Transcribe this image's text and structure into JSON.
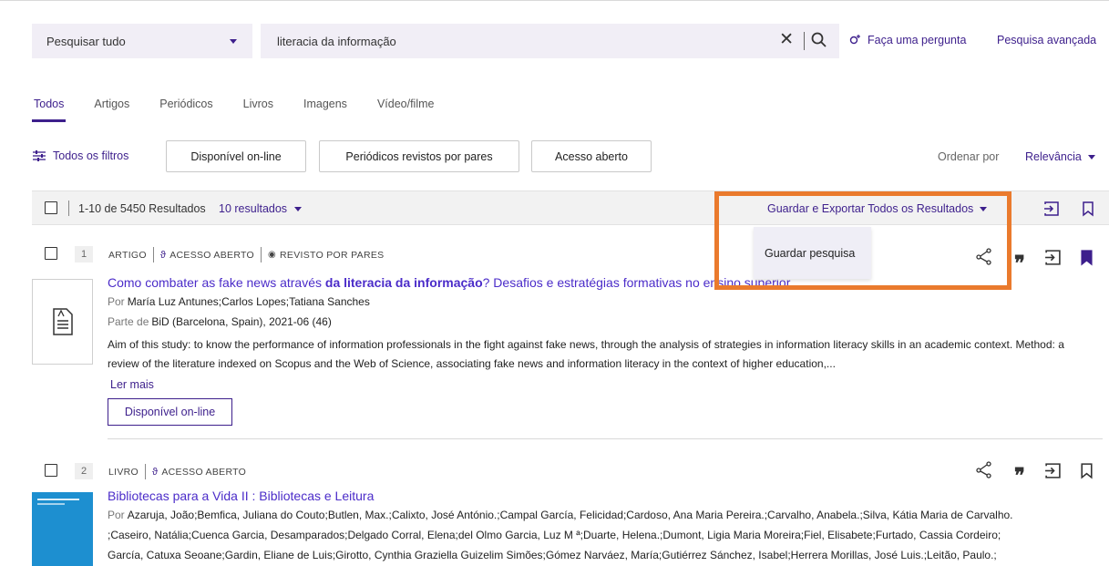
{
  "search": {
    "scope": "Pesquisar tudo",
    "query": "literacia da informação",
    "ask_label": "Faça uma pergunta",
    "advanced_label": "Pesquisa avançada"
  },
  "tabs": [
    {
      "label": "Todos",
      "active": true
    },
    {
      "label": "Artigos"
    },
    {
      "label": "Periódicos"
    },
    {
      "label": "Livros"
    },
    {
      "label": "Imagens"
    },
    {
      "label": "Vídeo/filme"
    }
  ],
  "filters": {
    "all_filters": "Todos os filtros",
    "chips": [
      "Disponível on-line",
      "Periódicos revistos por pares",
      "Acesso aberto"
    ],
    "sort_label": "Ordenar por",
    "sort_value": "Relevância"
  },
  "results_bar": {
    "range_text": "1-10 de 5450 Resultados",
    "per_page": "10 resultados",
    "export_label": "Guardar e Exportar Todos os Resultados",
    "dropdown_item": "Guardar pesquisa"
  },
  "results": [
    {
      "number": "1",
      "type": "ARTIGO",
      "access": "ACESSO ABERTO",
      "peer": "REVISTO POR PARES",
      "title_pre": "Como combater as fake news através ",
      "title_bold": "da literacia da informação",
      "title_post": "? Desafios e estratégias formativas no ensino superior",
      "by_label": "Por",
      "authors": "María Luz Antunes;Carlos Lopes;Tatiana Sanches",
      "part_label": "Parte de",
      "source": "BiD (Barcelona, Spain), 2021-06 (46)",
      "abstract": "Aim of this study: to know the performance of information professionals in the fight against fake news, through the analysis of strategies in information literacy skills in an academic context. Method: a review of the literature indexed on Scopus and the Web of Science, associating fake news and information literacy in the context of higher education,...",
      "read_more": "Ler mais",
      "availability": "Disponível on-line"
    },
    {
      "number": "2",
      "type": "LIVRO",
      "access": "ACESSO ABERTO",
      "title": "Bibliotecas para a Vida II : Bibliotecas e Leitura",
      "by_label": "Por",
      "authors_line1": "Azaruja, João;Bemfica, Juliana do Couto;Butlen, Max.;Calixto, José António.;Campal García, Felicidad;Cardoso, Ana Maria Pereira.;Carvalho, Anabela.;Silva, Kátia Maria de Carvalho.",
      "authors_line2": ";Caseiro, Natália;Cuenca Garcia, Desamparados;Delgado Corral, Elena;del Olmo Garcia, Luz M ª;Duarte, Helena.;Dumont, Ligia Maria Moreira;Fiel, Elisabete;Furtado, Cassia Cordeiro;",
      "authors_line3": "García, Catuxa Seoane;Gardin, Eliane de Luis;Girotto, Cynthia Graziella Guizelim Simões;Gómez Narváez, María;Gutiérrez Sánchez, Isabel;Herrera Morillas, José Luis.;Leitão, Paulo.;",
      "thumb_text": "Bibliotecas para a Vida II"
    }
  ],
  "colors": {
    "accent": "#3d1f8c",
    "link": "#4b2cc9",
    "highlight": "#ea7a2d",
    "input_bg": "#f1eef6"
  }
}
